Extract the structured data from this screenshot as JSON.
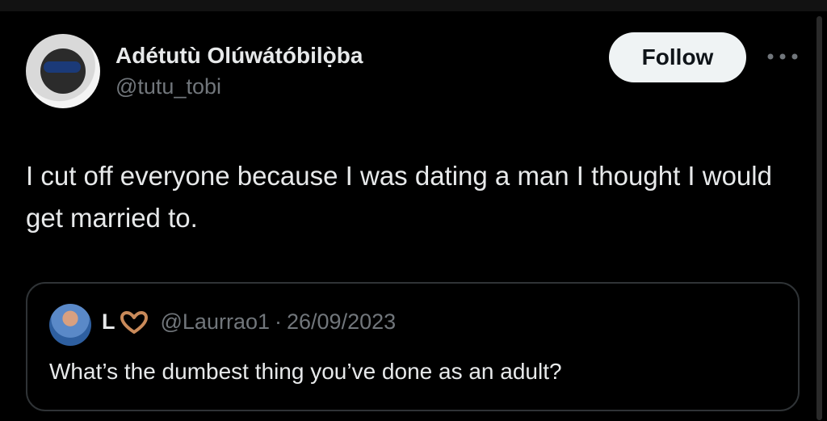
{
  "author": {
    "display_name": "Adétutù Olúwátóbilọ̀ba",
    "handle": "@tutu_tobi",
    "avatar_icon": "profile-avatar"
  },
  "actions": {
    "follow_label": "Follow",
    "more_icon": "more-horizontal-icon"
  },
  "tweet": {
    "text": "I cut off everyone because I was dating a man I thought I would get married to."
  },
  "quoted_tweet": {
    "display_name": "L",
    "name_emoji_icon": "heart-hands-icon",
    "handle": "@Laurrao1",
    "separator": "·",
    "date": "26/09/2023",
    "text": "What’s the dumbest thing you’ve done as an adult?"
  },
  "colors": {
    "background": "#000000",
    "primary_text": "#e7e9ea",
    "secondary_text": "#71767b",
    "follow_button_bg": "#eff3f4",
    "border": "#2f3336"
  }
}
